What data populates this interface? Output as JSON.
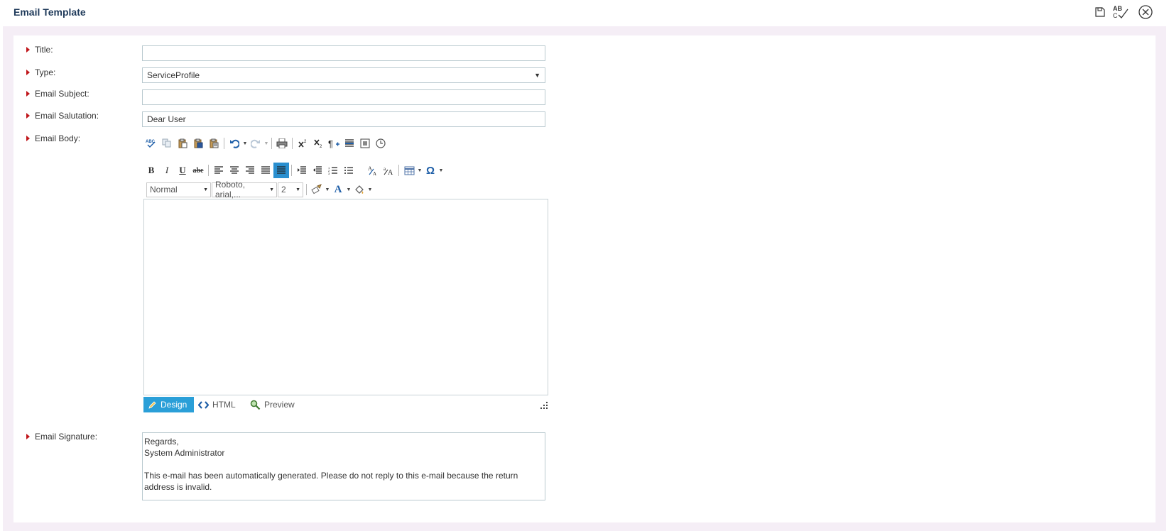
{
  "header": {
    "title": "Email Template",
    "icons": [
      "save-icon",
      "spellcheck-icon",
      "close-icon"
    ]
  },
  "form": {
    "title": {
      "label": "Title:",
      "value": ""
    },
    "type": {
      "label": "Type:",
      "selected": "ServiceProfile"
    },
    "subject": {
      "label": "Email Subject:",
      "value": ""
    },
    "salutation": {
      "label": "Email Salutation:",
      "value": "Dear User"
    },
    "body": {
      "label": "Email Body:"
    },
    "signature": {
      "label": "Email Signature:",
      "lines": [
        "Regards,",
        "System Administrator",
        "",
        "This e-mail has been automatically generated. Please do not reply to this e-mail because the return address is invalid."
      ]
    }
  },
  "editor": {
    "paragraph_style": "Normal",
    "font_name": "Roboto, arial,...",
    "font_size": "2",
    "modes": [
      "Design",
      "HTML",
      "Preview"
    ],
    "active_mode": "Design",
    "text_color_glyph": "A",
    "special_char_glyph": "Ω",
    "colors": {
      "accent": "#2a9fd8",
      "blue_icon": "#1f5fa8",
      "label_marker": "#c0161b"
    }
  }
}
